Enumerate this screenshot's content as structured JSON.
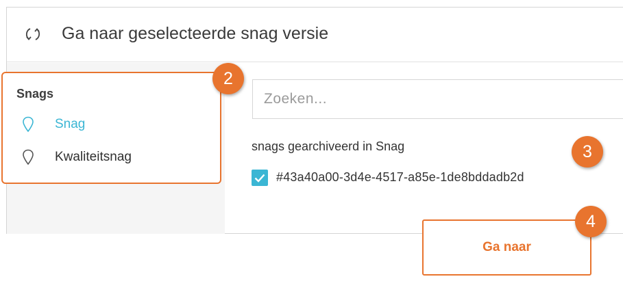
{
  "header": {
    "title": "Ga naar geselecteerde snag versie",
    "icon": "sync-icon"
  },
  "sidebar": {
    "heading": "Snags",
    "items": [
      {
        "label": "Snag",
        "icon": "map-pin-icon",
        "selected": true
      },
      {
        "label": "Kwaliteitsnag",
        "icon": "map-pin-icon",
        "selected": false
      }
    ]
  },
  "search": {
    "placeholder": "Zoeken...",
    "value": ""
  },
  "archived": {
    "label": "snags gearchiveerd in Snag",
    "items": [
      {
        "id": "#43a40a00-3d4e-4517-a85e-1de8bddadb2d",
        "checked": true
      }
    ]
  },
  "actions": {
    "go_label": "Ga naar"
  },
  "steps": {
    "two": "2",
    "three": "3",
    "four": "4"
  },
  "colors": {
    "accent_orange": "#e8742e",
    "accent_blue": "#3bb6d4",
    "text": "#333333"
  }
}
